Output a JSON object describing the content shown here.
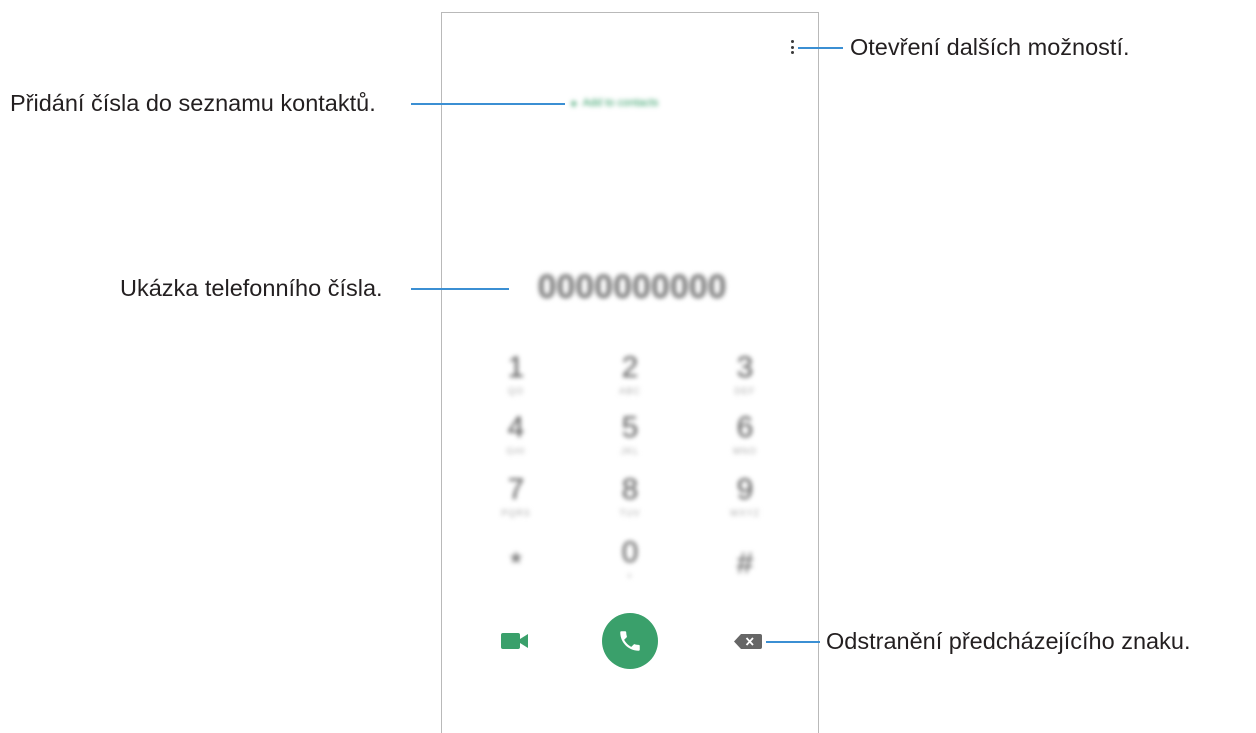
{
  "dialer": {
    "add_contacts": "Add to contacts",
    "number": "0000000000",
    "keys": [
      {
        "digit": "1",
        "letters": "QO"
      },
      {
        "digit": "2",
        "letters": "ABC"
      },
      {
        "digit": "3",
        "letters": "DEF"
      },
      {
        "digit": "4",
        "letters": "GHI"
      },
      {
        "digit": "5",
        "letters": "JKL"
      },
      {
        "digit": "6",
        "letters": "MNO"
      },
      {
        "digit": "7",
        "letters": "PQRS"
      },
      {
        "digit": "8",
        "letters": "TUV"
      },
      {
        "digit": "9",
        "letters": "WXYZ"
      },
      {
        "digit": "*",
        "letters": ""
      },
      {
        "digit": "0",
        "letters": "+"
      },
      {
        "digit": "#",
        "letters": ""
      }
    ],
    "icons": {
      "more": "more-options-icon",
      "video": "video-call-icon",
      "call": "phone-call-icon",
      "backspace": "backspace-icon"
    },
    "colors": {
      "accent_green": "#3aa06b",
      "callout_blue": "#3b8fd3"
    }
  },
  "callouts": {
    "more_options": "Otevření dalších možností.",
    "add_to_contacts": "Přidání čísla do seznamu kontaktů.",
    "number_preview": "Ukázka telefonního čísla.",
    "delete_char": "Odstranění předcházejícího znaku."
  }
}
